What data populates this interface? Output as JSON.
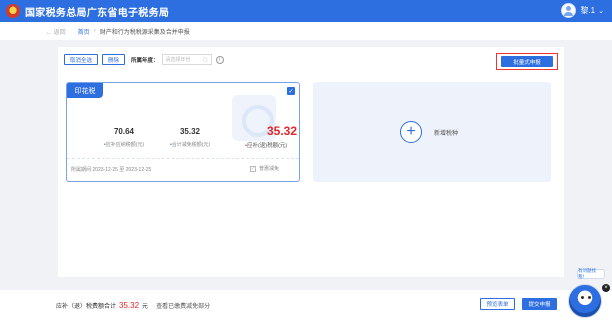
{
  "header": {
    "title": "国家税务总局广东省电子税务局",
    "user_name": "黎.1",
    "user_chevron": "⌄"
  },
  "breadcrumb": {
    "back": "← 返回",
    "home": "首页",
    "separator": "›",
    "current": "财产和行为税税源采集及合并申报"
  },
  "toolbar": {
    "cancel_select_label": "取消全选",
    "delete_label": "删除",
    "year_label": "所属年度：",
    "year_placeholder": "请选择年份",
    "info_icon": "info-icon",
    "declare_label": "批量式申报"
  },
  "tax_card": {
    "tag": "印花税",
    "payable_amount": "70.64",
    "payable_label": "应补应纳税额(元)",
    "reduction_amount": "35.32",
    "reduction_label": "合计减免税额(元)",
    "refund_amount": "35.32",
    "refund_label": "应补(退)税额(元)",
    "period": "所属期间 2023-12-25 至 2023-12-25",
    "benefit_label": "普惠减免",
    "checked": true
  },
  "add_card": {
    "plus": "+",
    "label": "新增税种"
  },
  "footer": {
    "total_prefix": "应补（退）税费额合计",
    "total_amount": "35.32",
    "total_unit": "元",
    "hint": "查看已缴费减免部分",
    "preview_label": "预览表单",
    "submit_label": "提交申报"
  },
  "assistant": {
    "bubble": "有问题找我！",
    "close": "×"
  },
  "colors": {
    "brand": "#2d6ee0",
    "alert": "#e3262a"
  }
}
